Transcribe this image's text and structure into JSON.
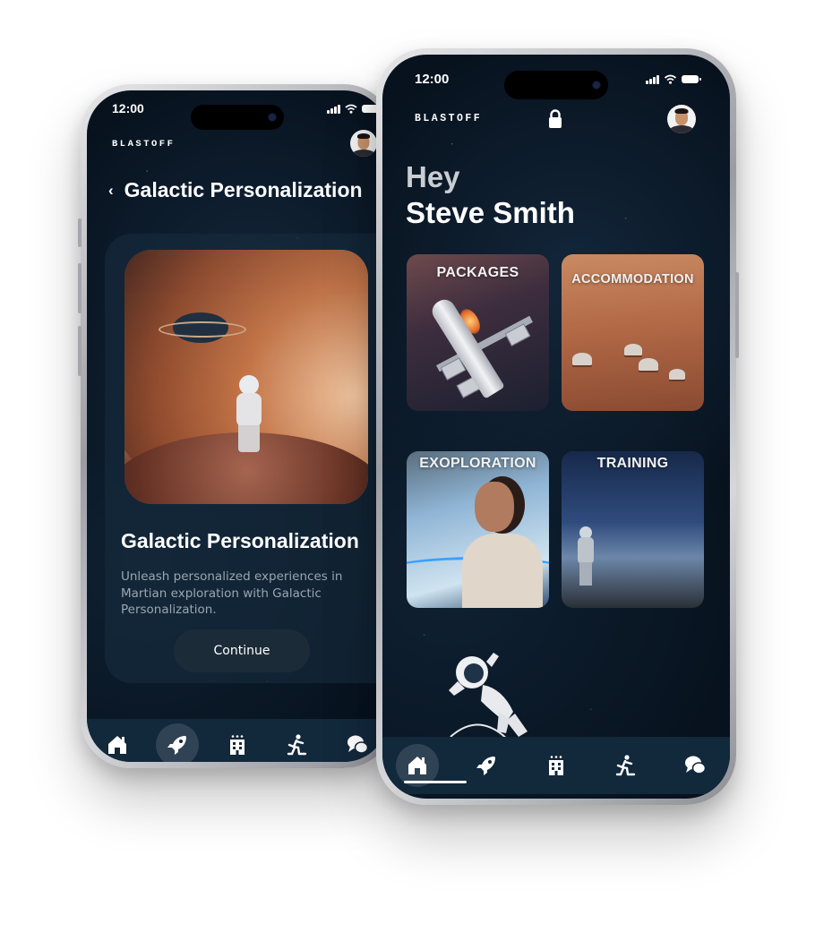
{
  "left_phone": {
    "status_time": "12:00",
    "brand": "BLASTOFF",
    "header": {
      "back_icon": "chevron-left-icon",
      "title": "Galactic Personalization"
    },
    "card": {
      "title": "Galactic Personalization",
      "description": "Unleash personalized experiences in Martian exploration with Galactic Personalization.",
      "button_label": "Continue"
    },
    "nav": [
      {
        "icon": "home-icon",
        "active": false
      },
      {
        "icon": "rocket-icon",
        "active": true
      },
      {
        "icon": "hotel-icon",
        "active": false
      },
      {
        "icon": "training-icon",
        "active": false
      },
      {
        "icon": "chat-icon",
        "active": false
      }
    ]
  },
  "right_phone": {
    "status_time": "12:00",
    "brand": "BLASTOFF",
    "lock_icon": "lock-icon",
    "greeting": {
      "hello": "Hey",
      "name": "Steve Smith"
    },
    "tiles": [
      {
        "label": "PACKAGES"
      },
      {
        "label": "ACCOMMODATION"
      },
      {
        "label": "EXOPLORATION"
      },
      {
        "label": "TRAINING"
      }
    ],
    "nav": [
      {
        "icon": "home-icon",
        "active": true
      },
      {
        "icon": "rocket-icon",
        "active": false
      },
      {
        "icon": "hotel-icon",
        "active": false
      },
      {
        "icon": "training-icon",
        "active": false
      },
      {
        "icon": "chat-icon",
        "active": false
      }
    ]
  },
  "colors": {
    "screen_bg": "#07121e",
    "navbar_bg": "#12283b",
    "button_bg": "#1c2b38",
    "description_text": "#9aa6b3"
  }
}
